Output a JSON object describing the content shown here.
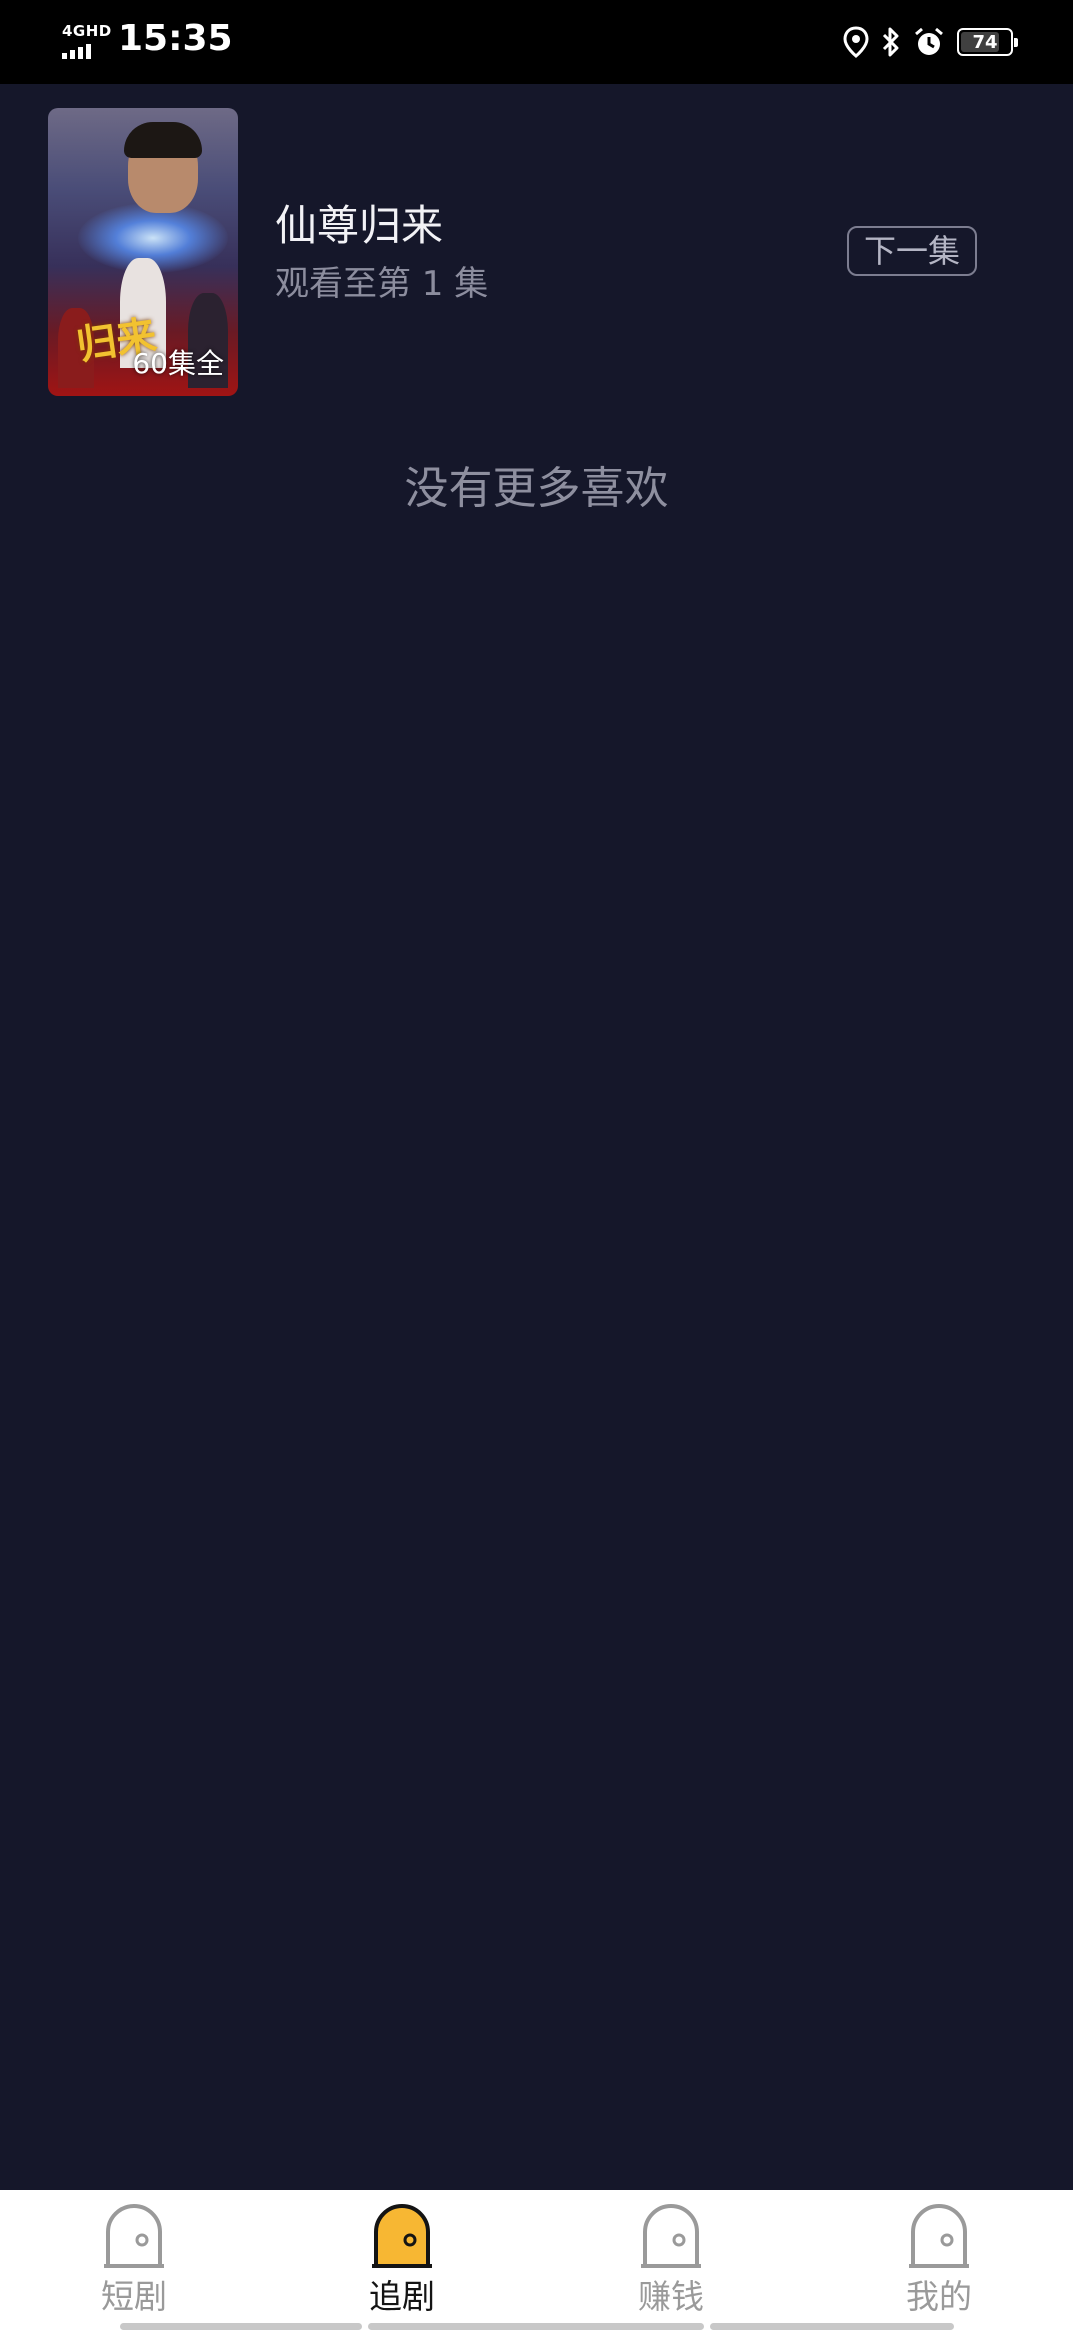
{
  "status_bar": {
    "network": "4GHD",
    "time": "15:35",
    "battery": "74",
    "battery_level": 0.74
  },
  "watching": {
    "title": "仙尊归来",
    "progress": "观看至第 1 集",
    "cover_badge": "60集全",
    "next_label": "下一集"
  },
  "empty_hint": "没有更多喜欢",
  "tabs": [
    {
      "label": "短剧",
      "icon": "shorts-icon",
      "active": false
    },
    {
      "label": "追剧",
      "icon": "follow-icon",
      "active": true
    },
    {
      "label": "赚钱",
      "icon": "earn-icon",
      "active": false
    },
    {
      "label": "我的",
      "icon": "profile-icon",
      "active": false
    }
  ],
  "colors": {
    "background": "#15172a",
    "tab_active": "#f7b733",
    "tab_inactive": "#9a9a9a"
  }
}
